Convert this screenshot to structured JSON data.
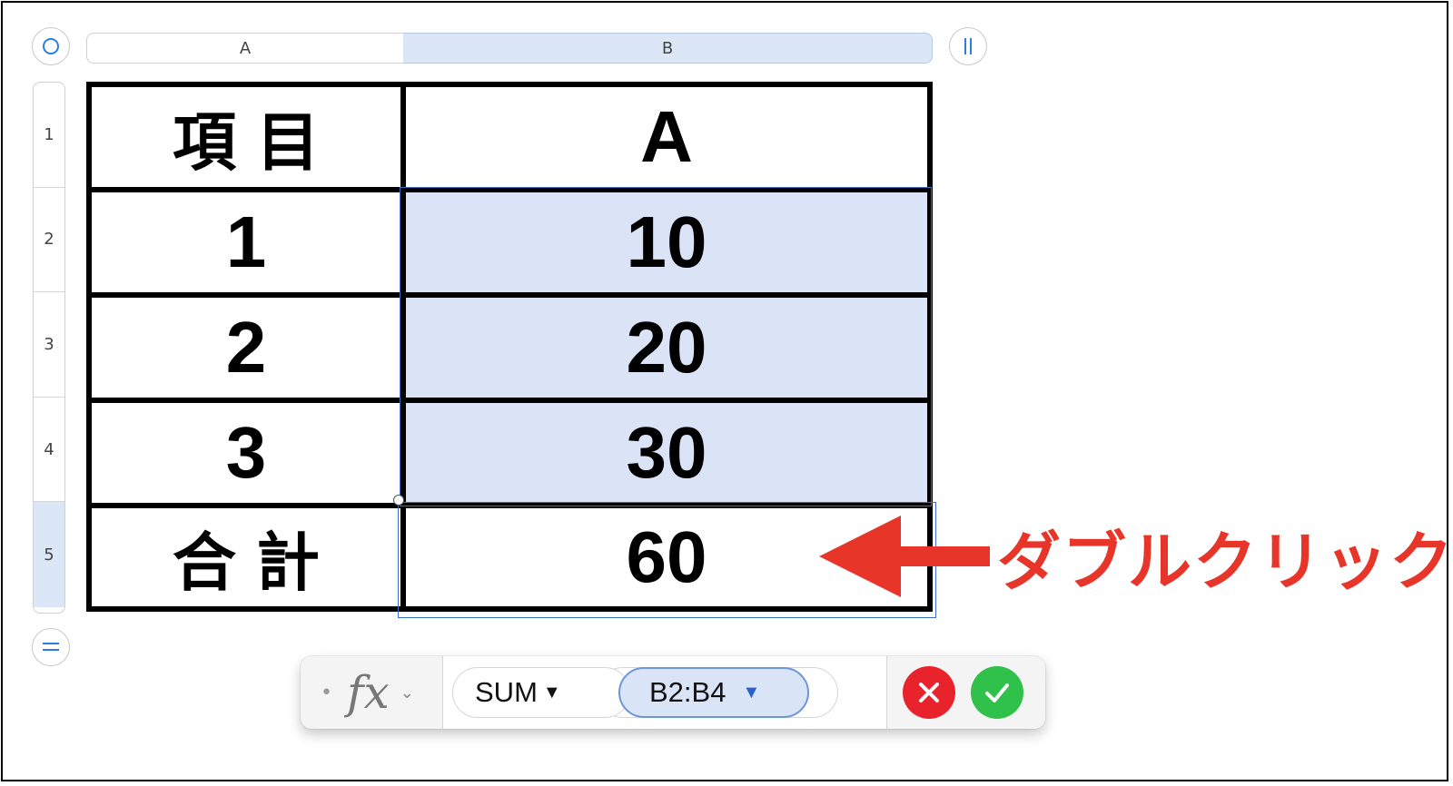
{
  "columns": [
    {
      "label": "A"
    },
    {
      "label": "B"
    }
  ],
  "rows": [
    "1",
    "2",
    "3",
    "4",
    "5"
  ],
  "table": {
    "header": {
      "item": "項目",
      "value": "A"
    },
    "rows": [
      {
        "item": "1",
        "value": "10"
      },
      {
        "item": "2",
        "value": "20"
      },
      {
        "item": "3",
        "value": "30"
      }
    ],
    "total": {
      "item": "合計",
      "value": "60"
    }
  },
  "annotation": {
    "text": "ダブルクリック",
    "color": "#e8352a"
  },
  "formula_bar": {
    "function": "SUM",
    "range": "B2:B4"
  },
  "icons": {
    "table_select": "circle-icon",
    "column_handle": "pause-bars-icon",
    "row_handle": "equals-icon",
    "cancel": "x-icon",
    "accept": "check-icon"
  },
  "colors": {
    "selection": "#dbe4f7",
    "selection_border": "#3a6fc8",
    "cancel": "#e8232c",
    "accept": "#2fc14a"
  }
}
